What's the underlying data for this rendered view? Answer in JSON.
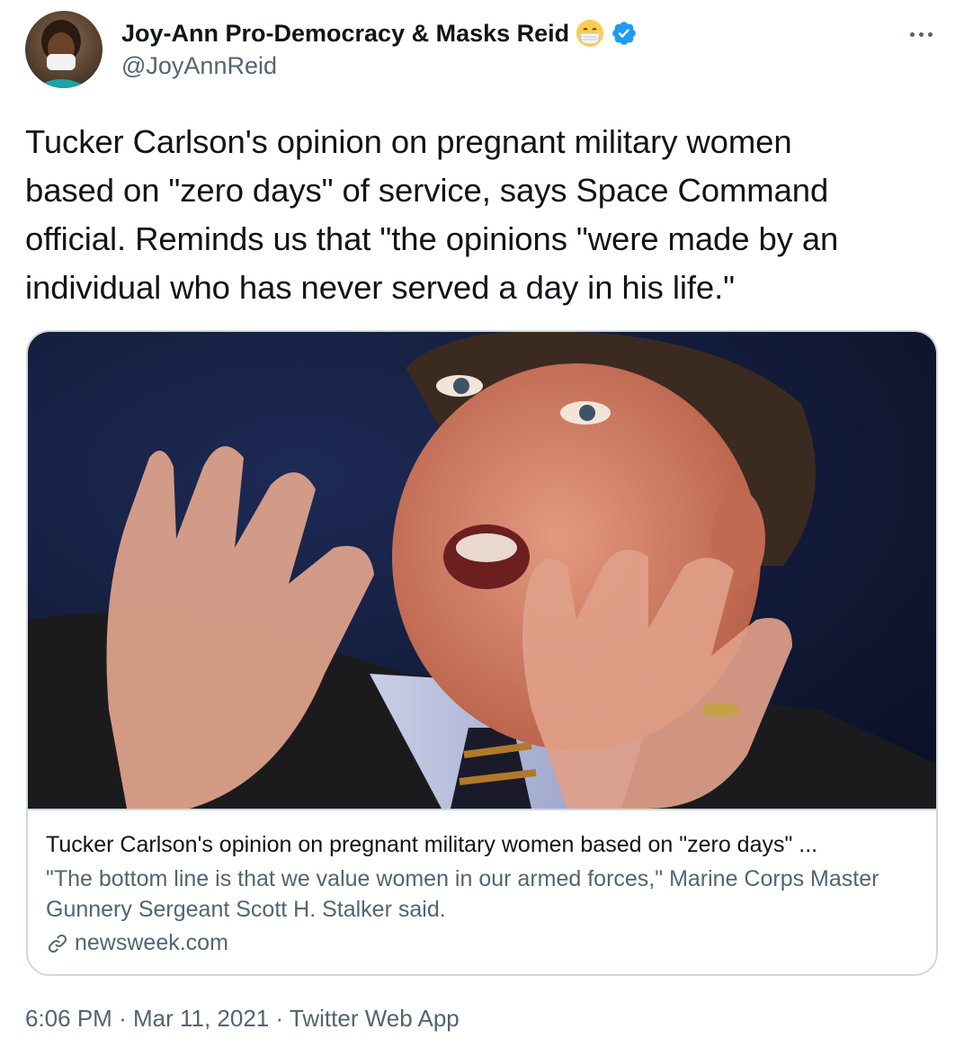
{
  "author": {
    "display_name": "Joy-Ann Pro-Democracy & Masks Reid",
    "handle": "@JoyAnnReid",
    "emoji_icon": "face-with-medical-mask-icon",
    "verified_icon": "verified-badge-icon",
    "verified_color": "#1d9bf0"
  },
  "tweet": {
    "text": "Tucker Carlson's opinion on pregnant military women\nbased on \"zero days\" of service, says Space Command\nofficial. Reminds us that \"the opinions \"were made by an\nindividual who has never served a day in his life.\""
  },
  "card": {
    "title": "Tucker Carlson's opinion on pregnant military women based on \"zero days\" ...",
    "description": "\"The bottom line is that we value women in our armed forces,\" Marine Corps Master Gunnery Sergeant Scott H. Stalker said.",
    "domain": "newsweek.com",
    "link_icon": "link-icon"
  },
  "footer": {
    "time": "6:06 PM",
    "separator": "·",
    "date": "Mar 11, 2021",
    "source": "Twitter Web App"
  },
  "colors": {
    "text_primary": "#0f1419",
    "text_secondary": "#536471",
    "border": "#cfd9de"
  }
}
